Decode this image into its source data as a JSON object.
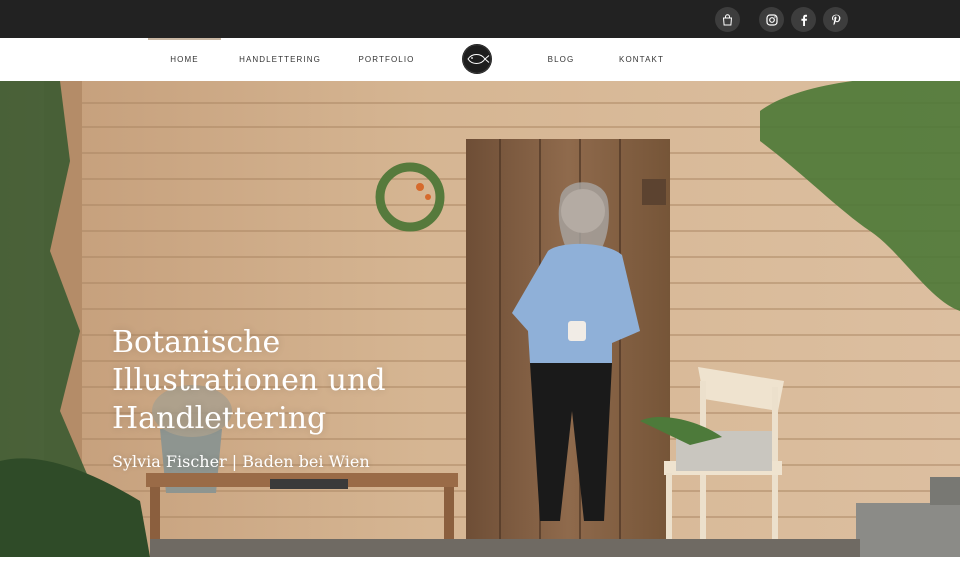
{
  "topbar": {
    "icons": [
      {
        "name": "shopping-bag-icon",
        "glyph": "bag"
      },
      {
        "name": "instagram-icon",
        "glyph": "instagram"
      },
      {
        "name": "facebook-icon",
        "glyph": "f"
      },
      {
        "name": "pinterest-icon",
        "glyph": "p"
      }
    ]
  },
  "nav": {
    "items": [
      {
        "label": "HOME",
        "active": true
      },
      {
        "label": "HANDLETTERING"
      },
      {
        "label": "PORTFOLIO"
      },
      {
        "label": "BLOG"
      },
      {
        "label": "KONTAKT"
      }
    ],
    "logo_icon": "fish-logo-icon"
  },
  "hero": {
    "title": "Botanische Illustrationen und Handlettering",
    "subtitle": "Sylvia Fischer | Baden bei Wien"
  },
  "colors": {
    "topbar": "#222222",
    "nav_background": "#ffffff",
    "active_indicator": "#c9b7a3",
    "wood": "#cfa882",
    "door": "#8a6548"
  }
}
